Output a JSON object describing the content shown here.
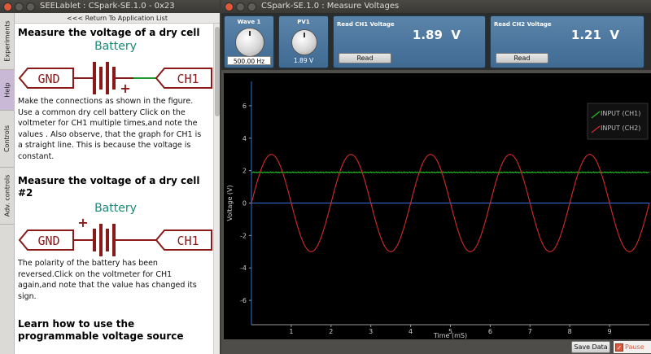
{
  "left_window": {
    "title": "SEELablet : CSpark-SE.1.0 - 0x23",
    "return_link": "<<< Return To Application List",
    "tabs": [
      "Experiments",
      "Help",
      "Controls",
      "Adv. controls"
    ],
    "sections": [
      {
        "title": "Measure the voltage of a dry cell",
        "diagram": {
          "battery": "Battery",
          "left": "GND",
          "right": "CH1",
          "polarity": "+"
        },
        "text": "Make the connections as shown in the figure. Use a common dry cell battery Click on the voltmeter for CH1 multiple times,and note the values . Also observe, that the graph for CH1 is a straight line. This is because the voltage is constant."
      },
      {
        "title": "Measure the voltage of a dry cell #2",
        "diagram": {
          "battery": "Battery",
          "left": "GND",
          "right": "CH1",
          "polarity": "+"
        },
        "text": "The polarity of the battery has been reversed.Click on the voltmeter for CH1 again,and note that the value has changed its sign."
      },
      {
        "title": "Learn how to use the programmable voltage source"
      }
    ]
  },
  "right_window": {
    "title": "CSpark-SE.1.0 : Measure Voltages",
    "wave1": {
      "label": "Wave 1",
      "value": "500.00 Hz"
    },
    "pv1": {
      "label": "PV1",
      "value": "1.89 V"
    },
    "ch1": {
      "label": "Read CH1 Voltage",
      "value": "1.89",
      "unit": "V",
      "button": "Read"
    },
    "ch2": {
      "label": "Read CH2 Voltage",
      "value": "1.21",
      "unit": "V",
      "button": "Read"
    },
    "save_button": "Save Data",
    "pause_label": "Pause"
  },
  "chart_data": {
    "type": "line",
    "title": "",
    "xlabel": "Time (mS)",
    "ylabel": "Voltage (V)",
    "xlim": [
      0,
      10
    ],
    "ylim": [
      -7.5,
      7.5
    ],
    "xticks": [
      1,
      2,
      3,
      4,
      5,
      6,
      7,
      8,
      9
    ],
    "yticks": [
      6,
      4,
      2,
      0,
      -2,
      -4,
      -6
    ],
    "grid": false,
    "legend_position": "top-right",
    "series": [
      {
        "name": "INPUT (CH1)",
        "color": "#22c322",
        "kind": "constant",
        "value": 1.89
      },
      {
        "name": "INPUT (CH2)",
        "color": "#d42a2a",
        "kind": "sine",
        "amplitude": 3.0,
        "frequency_per_ms": 0.5,
        "phase_deg": 0
      }
    ],
    "reference_lines": [
      {
        "orientation": "horizontal",
        "value": 0,
        "color": "#2f6fe0"
      },
      {
        "orientation": "vertical",
        "value": 0,
        "color": "#2f6fe0"
      }
    ]
  }
}
